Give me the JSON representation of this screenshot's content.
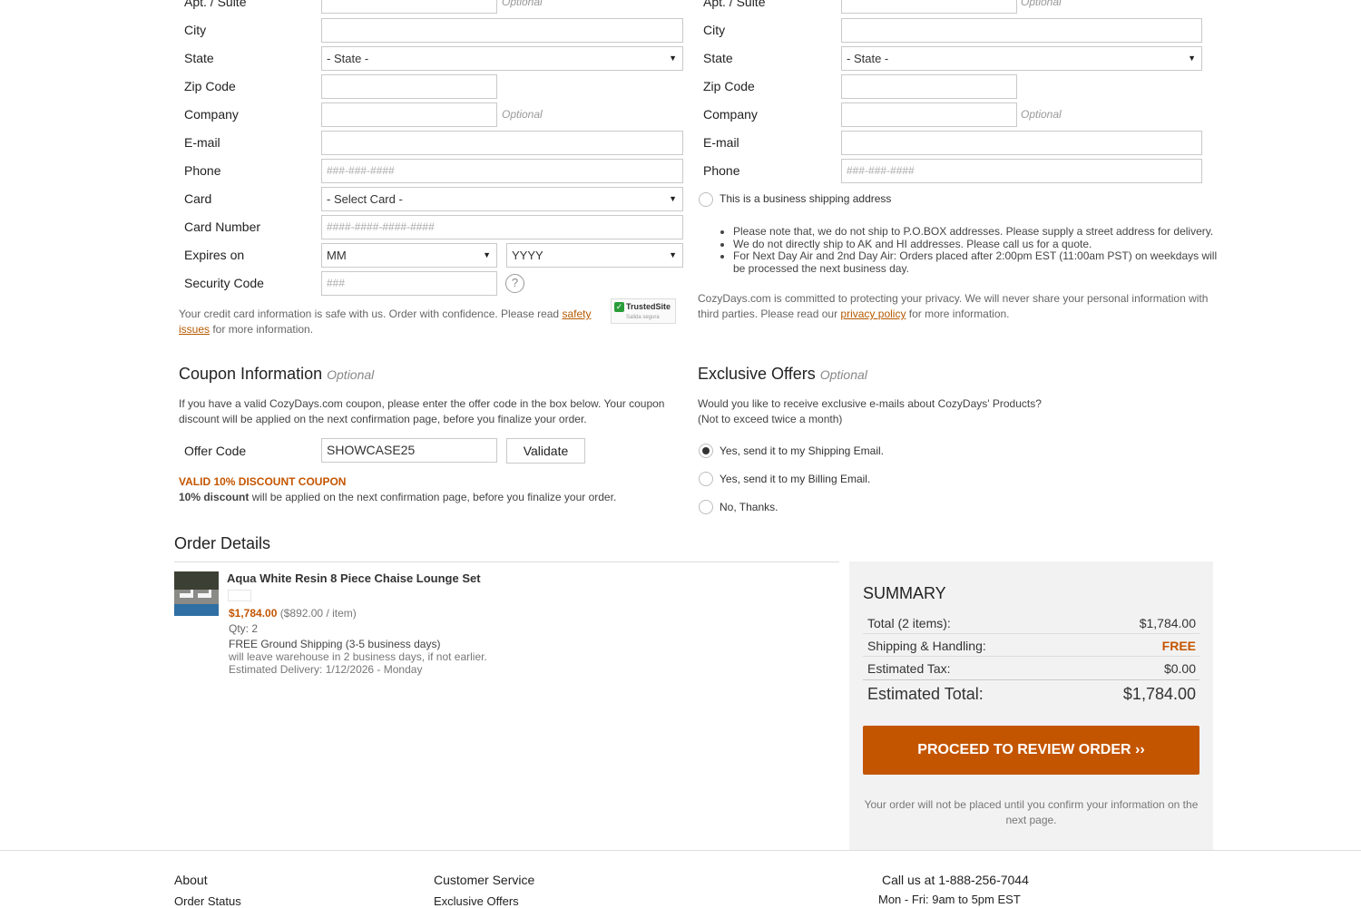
{
  "billing": {
    "apt_label": "Apt. / Suite",
    "apt_optional": "Optional",
    "city_label": "City",
    "state_label": "State",
    "state_value": "- State -",
    "zip_label": "Zip Code",
    "company_label": "Company",
    "company_optional": "Optional",
    "email_label": "E-mail",
    "phone_label": "Phone",
    "phone_placeholder": "###-###-####",
    "card_label": "Card",
    "card_value": "- Select Card -",
    "card_number_label": "Card Number",
    "card_number_placeholder": "####-####-####-####",
    "expires_label": "Expires on",
    "month_value": "MM",
    "year_value": "YYYY",
    "security_label": "Security Code",
    "security_placeholder": "###",
    "help_icon": "?",
    "safe_text_1": "Your credit card information is safe with us. Order with confidence. Please read ",
    "safe_link_1": "safety",
    "safe_link_2": "issues",
    "safe_text_2": " for more information.",
    "trusted_badge": "TrustedSite",
    "trusted_sub": "Salida segura"
  },
  "shipping": {
    "apt_label": "Apt. / Suite",
    "apt_optional": "Optional",
    "city_label": "City",
    "state_label": "State",
    "state_value": "- State -",
    "zip_label": "Zip Code",
    "company_label": "Company",
    "company_optional": "Optional",
    "email_label": "E-mail",
    "phone_label": "Phone",
    "phone_placeholder": "###-###-####",
    "business_label": "This is a business shipping address",
    "notes": [
      "Please note that, we do not ship to P.O.BOX addresses. Please supply a street address for delivery.",
      "We do not directly ship to AK and HI addresses. Please call us for a quote.",
      "For Next Day Air and 2nd Day Air: Orders placed after 2:00pm EST (11:00am PST) on weekdays will be processed the next business day."
    ],
    "privacy_text_1": "CozyDays.com is committed to protecting your privacy. We will never share your personal information with third parties. Please read our ",
    "privacy_link": "privacy policy",
    "privacy_text_2": " for more information."
  },
  "coupon": {
    "title": "Coupon Information",
    "optional": "Optional",
    "desc": "If you have a valid CozyDays.com coupon, please enter the offer code in the box below. Your coupon discount will be applied on the next confirmation page, before you finalize your order.",
    "offer_label": "Offer Code",
    "offer_value": "SHOWCASE25",
    "validate_label": "Validate",
    "valid_msg": "VALID 10% DISCOUNT COUPON",
    "discount_bold": "10% discount",
    "discount_rest": " will be applied on the next confirmation page, before you finalize your order."
  },
  "offers": {
    "title": "Exclusive Offers",
    "optional": "Optional",
    "desc_1": "Would you like to receive exclusive e-mails about CozyDays' Products?",
    "desc_2": "(Not to exceed twice a month)",
    "options": [
      "Yes, send it to my Shipping Email.",
      "Yes, send it to my Billing Email.",
      "No, Thanks."
    ],
    "selected_index": 0
  },
  "order": {
    "title": "Order Details",
    "item_name": "Aqua White Resin 8 Piece Chaise Lounge Set",
    "item_price": "$1,784.00",
    "item_unit": "($892.00 / item)",
    "qty": "Qty: 2",
    "shipping_line": "FREE Ground Shipping (3-5 business days)",
    "warehouse_line": "will leave warehouse in 2 business days, if not earlier.",
    "delivery_line": "Estimated Delivery: 1/12/2026 - Monday"
  },
  "summary": {
    "title": "SUMMARY",
    "total_label": "Total (2 items):",
    "total_value": "$1,784.00",
    "shipping_label": "Shipping & Handling:",
    "shipping_value": "FREE",
    "tax_label": "Estimated Tax:",
    "tax_value": "$0.00",
    "est_label": "Estimated Total:",
    "est_value": "$1,784.00",
    "proceed_label": "PROCEED TO REVIEW ORDER ››",
    "note": "Your order will not be placed until you confirm your information on the next page."
  },
  "footer": {
    "about": "About",
    "order_status": "Order Status",
    "customer_service": "Customer Service",
    "exclusive_offers": "Exclusive Offers",
    "call": "Call us at 1-888-256-7044",
    "hours": "Mon - Fri: 9am to 5pm EST"
  },
  "colors": {
    "accent": "#c45500",
    "link": "#b55a00",
    "summary_bg": "#f2f2f2"
  }
}
